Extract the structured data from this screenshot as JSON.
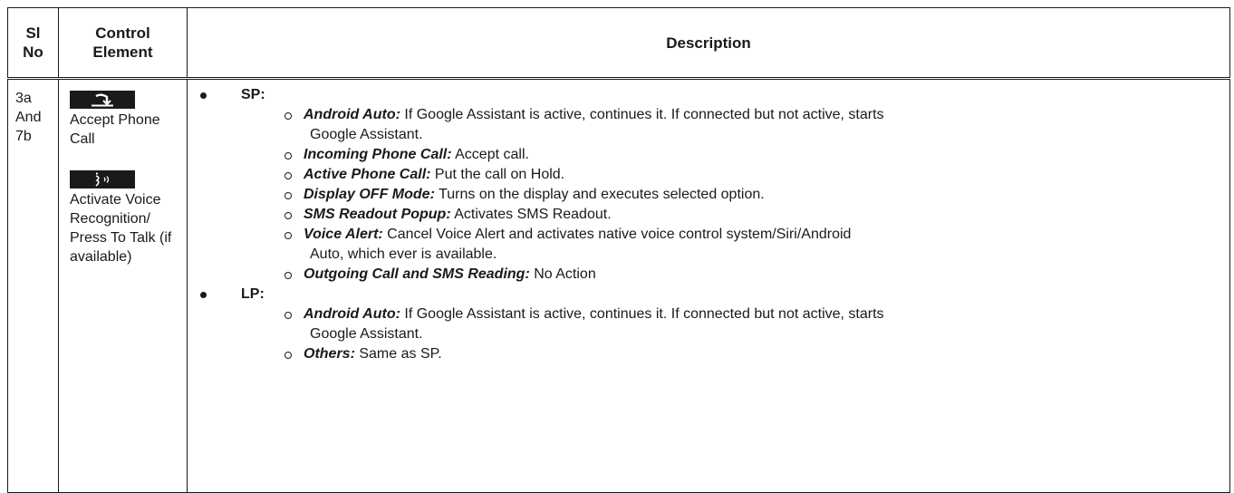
{
  "header": {
    "sl_no": "Sl No",
    "control_element": "Control Element",
    "description": "Description"
  },
  "row": {
    "sl_no": "3a And 7b",
    "controls": [
      {
        "icon": "accept-call-icon",
        "label": "Accept Phone Call"
      },
      {
        "icon": "voice-recognition-icon",
        "label": "Activate Voice Recognition/ Press To Talk (if available)"
      }
    ],
    "sections": [
      {
        "title": "SP:",
        "items": [
          {
            "term": "Android Auto:",
            "text": " If Google Assistant is active, continues it. If connected but not active, starts",
            "cont": "Google Assistant."
          },
          {
            "term": "Incoming Phone Call:",
            "text": " Accept call."
          },
          {
            "term": "Active Phone Call:",
            "text": " Put the call on Hold."
          },
          {
            "term": "Display OFF Mode:",
            "text": " Turns on the display and executes selected option."
          },
          {
            "term": "SMS Readout Popup:",
            "text": " Activates SMS Readout."
          },
          {
            "term": "Voice Alert:",
            "text": " Cancel Voice Alert and activates native voice control system/Siri/Android",
            "cont": "Auto, which ever is available."
          },
          {
            "term": "Outgoing Call and SMS Reading:",
            "text": " No Action"
          }
        ]
      },
      {
        "title": "LP:",
        "items": [
          {
            "term": "Android Auto:",
            "text": " If Google Assistant is active, continues it. If connected but not active, starts",
            "cont": "Google Assistant."
          },
          {
            "term": "Others:",
            "text": " Same as SP."
          }
        ]
      }
    ]
  }
}
